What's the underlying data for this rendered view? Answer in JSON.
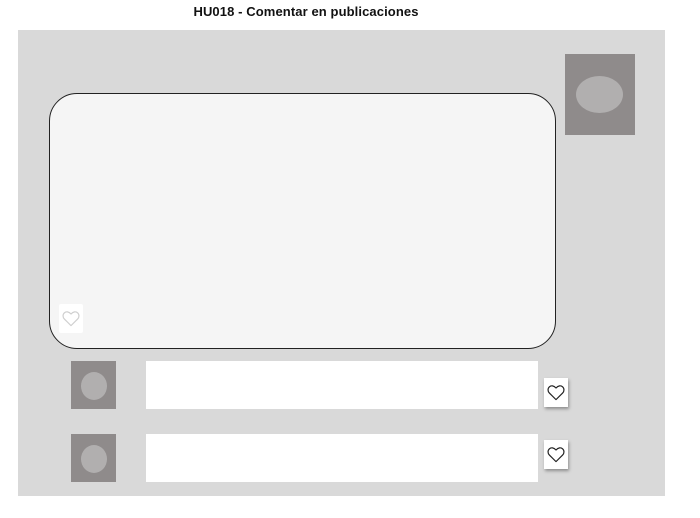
{
  "page": {
    "title": "HU018 - Comentar en publicaciones"
  },
  "post": {
    "like_icon": "heart-outline-icon"
  },
  "comments": [
    {
      "value": "",
      "like_icon": "heart-outline-icon"
    },
    {
      "value": "",
      "like_icon": "heart-outline-icon"
    }
  ],
  "colors": {
    "frame_background": "#d9d9d9",
    "avatar_placeholder": "#8f8b8b",
    "avatar_face": "#b1afaf",
    "post_background": "#f5f5f5",
    "comment_background": "#ffffff"
  }
}
